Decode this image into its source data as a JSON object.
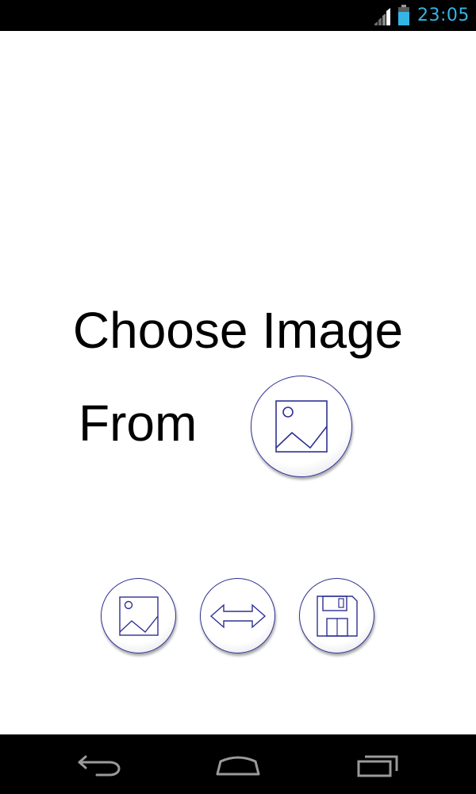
{
  "status_bar": {
    "time": "23:05",
    "clock_color": "#33b5e5",
    "icons": [
      "signal-icon",
      "battery-icon"
    ]
  },
  "main": {
    "title": "Choose Image",
    "from_label": "From",
    "choose_button_icon": "image-icon"
  },
  "toolbar": {
    "buttons": [
      {
        "icon": "image-icon"
      },
      {
        "icon": "double-arrow-icon"
      },
      {
        "icon": "floppy-disk-icon"
      }
    ],
    "accent": "#2e3192"
  },
  "nav_bar": {
    "icons": [
      "back-icon",
      "home-icon",
      "recent-apps-icon"
    ]
  }
}
